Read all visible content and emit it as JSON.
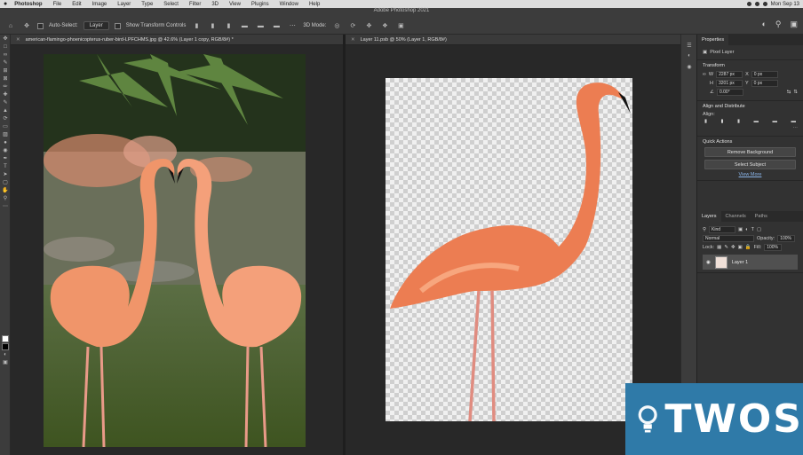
{
  "menubar": {
    "app": "Photoshop",
    "items": [
      "File",
      "Edit",
      "Image",
      "Layer",
      "Type",
      "Select",
      "Filter",
      "3D",
      "View",
      "Plugins",
      "Window",
      "Help"
    ],
    "clock": "Mon Sep 13"
  },
  "window_title": "Adobe Photoshop 2021",
  "options": {
    "auto_select_label": "Auto-Select:",
    "auto_select_value": "Layer",
    "transform_controls_label": "Show Transform Controls",
    "mode_3d": "3D Mode:"
  },
  "documents": {
    "left_tab": "american-flamingo-phoenicopterus-ruber-bird-LPFCHMS.jpg @ 42.6% (Layer 1 copy, RGB/8#) *",
    "right_tab": "Layer 11.psb @ 50% (Layer 1, RGB/8#)"
  },
  "properties": {
    "tab_label": "Properties",
    "kind": "Pixel Layer",
    "transform_title": "Transform",
    "w_label": "W",
    "w_value": "2287 px",
    "h_label": "H",
    "h_value": "3201 px",
    "x_label": "X",
    "x_value": "0 px",
    "y_label": "Y",
    "y_value": "0 px",
    "angle_value": "0.00°",
    "align_title": "Align and Distribute",
    "align_label": "Align:",
    "quick_title": "Quick Actions",
    "remove_bg": "Remove Background",
    "select_subject": "Select Subject",
    "view_more": "View More"
  },
  "layers": {
    "tabs": [
      "Layers",
      "Channels",
      "Paths"
    ],
    "kind": "Kind",
    "blend": "Normal",
    "opacity_label": "Opacity:",
    "opacity_value": "100%",
    "lock_label": "Lock:",
    "fill_label": "Fill:",
    "fill_value": "100%",
    "layer_name": "Layer 1"
  },
  "watermark": {
    "text": "TWOS"
  }
}
